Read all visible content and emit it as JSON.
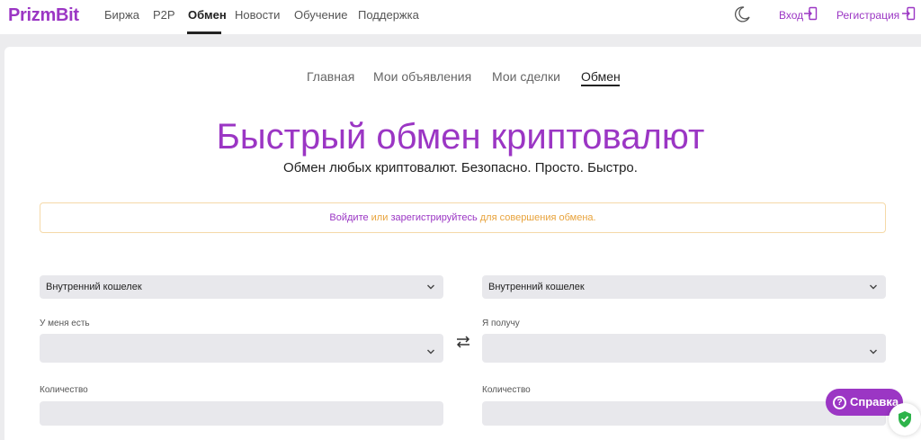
{
  "header": {
    "logo": "PrizmBit",
    "nav": [
      "Биржа",
      "P2P",
      "Обмен",
      "Новости",
      "Обучение",
      "Поддержка"
    ],
    "login": "Вход",
    "register": "Регистрация"
  },
  "subnav": [
    "Главная",
    "Мои объявления",
    "Мои сделки",
    "Обмен"
  ],
  "hero": {
    "title": "Быстрый обмен криптовалют",
    "subtitle": "Обмен любых криптовалют. Безопасно. Просто. Быстро."
  },
  "notice": {
    "login_link": "Войдите",
    "or": " или ",
    "register_link": "зарегистрируйтесь",
    "tail": " для совершения обмена."
  },
  "exchange": {
    "left": {
      "wallet": "Внутренний кошелек",
      "have_label": "У меня есть",
      "have_value": "",
      "qty_label": "Количество",
      "qty_value": ""
    },
    "right": {
      "wallet": "Внутренний кошелек",
      "get_label": "Я получу",
      "get_value": "",
      "qty_label": "Количество",
      "qty_value": ""
    }
  },
  "help": {
    "label": "Справка",
    "icon": "question-icon"
  },
  "colors": {
    "brand": "#9b36c4",
    "notice": "#e8a33c",
    "field_bg": "#e8e8ec"
  }
}
